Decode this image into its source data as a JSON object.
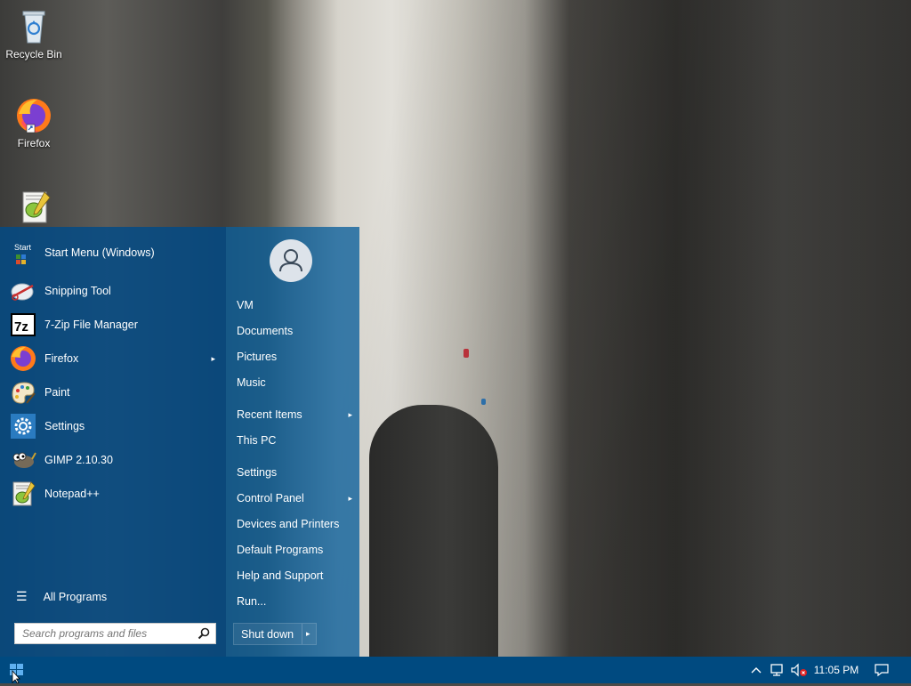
{
  "desktop": {
    "icons": [
      {
        "label": "Recycle Bin",
        "icon": "recycle-bin-icon"
      },
      {
        "label": "Firefox",
        "icon": "firefox-icon"
      },
      {
        "label": "Notepad++",
        "icon": "notepad-plus-plus-icon"
      }
    ]
  },
  "start_menu": {
    "programs": [
      {
        "label": "Start Menu (Windows)",
        "icon": "start-menu-windows-icon",
        "has_submenu": false
      },
      {
        "label": "Snipping Tool",
        "icon": "snipping-tool-icon",
        "has_submenu": false
      },
      {
        "label": "7-Zip File Manager",
        "icon": "7zip-icon",
        "has_submenu": false
      },
      {
        "label": "Firefox",
        "icon": "firefox-icon",
        "has_submenu": true
      },
      {
        "label": "Paint",
        "icon": "paint-icon",
        "has_submenu": false
      },
      {
        "label": "Settings",
        "icon": "settings-gear-icon",
        "has_submenu": false
      },
      {
        "label": "GIMP 2.10.30",
        "icon": "gimp-icon",
        "has_submenu": false
      },
      {
        "label": "Notepad++",
        "icon": "notepad-plus-plus-icon",
        "has_submenu": false
      }
    ],
    "start_icon_text": "Start",
    "seven_zip_glyph": "7z",
    "all_programs": "All Programs",
    "search_placeholder": "Search programs and files",
    "right_items": [
      {
        "label": "VM",
        "has_submenu": false
      },
      {
        "label": "Documents",
        "has_submenu": false
      },
      {
        "label": "Pictures",
        "has_submenu": false
      },
      {
        "label": "Music",
        "has_submenu": false
      },
      {
        "label": "Recent Items",
        "has_submenu": true
      },
      {
        "label": "This PC",
        "has_submenu": false
      },
      {
        "label": "Settings",
        "has_submenu": false
      },
      {
        "label": "Control Panel",
        "has_submenu": true
      },
      {
        "label": "Devices and Printers",
        "has_submenu": false
      },
      {
        "label": "Default Programs",
        "has_submenu": false
      },
      {
        "label": "Help and Support",
        "has_submenu": false
      },
      {
        "label": "Run...",
        "has_submenu": false
      }
    ],
    "shutdown_label": "Shut down",
    "arrow": "▸"
  },
  "taskbar": {
    "clock": "11:05 PM",
    "tray_icons": [
      "chevron-up-icon",
      "network-icon",
      "volume-muted-icon",
      "notification-icon"
    ]
  },
  "colors": {
    "taskbar": "#004a80",
    "start_left": "#004b87",
    "start_right": "#0a5f9b"
  }
}
